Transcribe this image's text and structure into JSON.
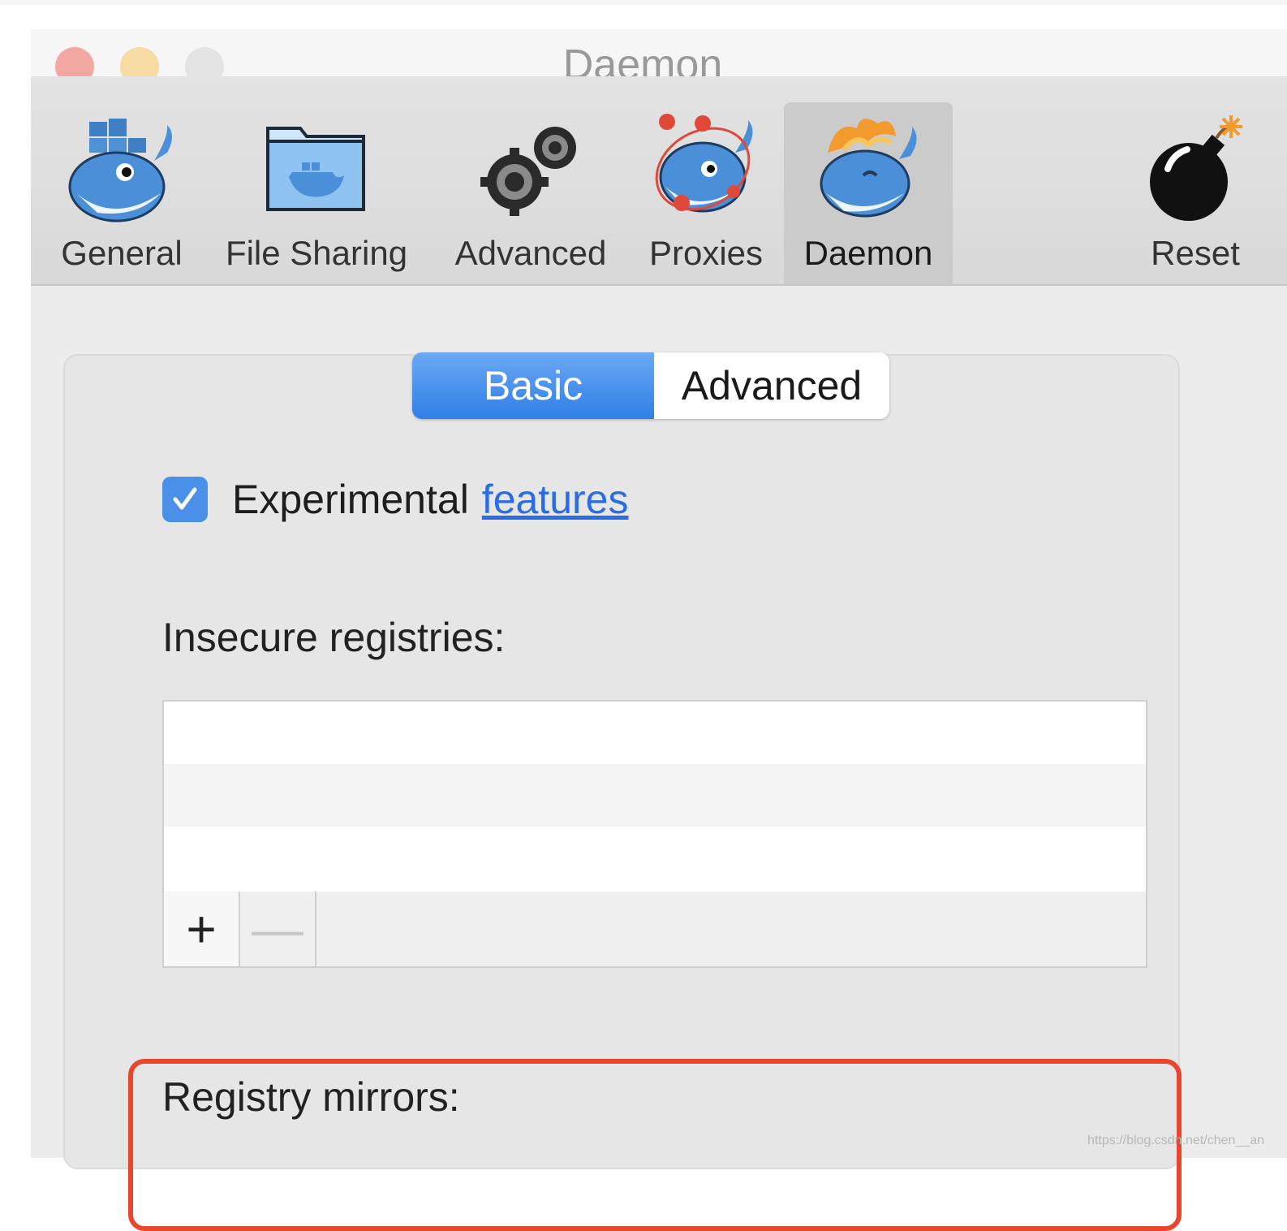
{
  "window": {
    "title": "Daemon"
  },
  "toolbar": {
    "items": [
      {
        "label": "General",
        "icon": "docker-whale-icon"
      },
      {
        "label": "File Sharing",
        "icon": "folder-icon"
      },
      {
        "label": "Advanced",
        "icon": "gears-icon"
      },
      {
        "label": "Proxies",
        "icon": "proxy-whale-icon"
      },
      {
        "label": "Daemon",
        "icon": "daemon-whale-icon",
        "selected": true
      },
      {
        "label": "Reset",
        "icon": "bomb-icon"
      }
    ]
  },
  "tabs": {
    "basic": "Basic",
    "advanced": "Advanced",
    "selected": "Basic"
  },
  "experimental": {
    "checked": true,
    "label": "Experimental",
    "link": "features"
  },
  "insecure_registries": {
    "label": "Insecure registries:",
    "add": "+",
    "remove": "—"
  },
  "registry_mirrors": {
    "label": "Registry mirrors:"
  },
  "watermark": "https://blog.csdn.net/chen__an",
  "colors": {
    "accent": "#2f7fe6",
    "highlight": "#e8472e",
    "link": "#2a6de2"
  }
}
